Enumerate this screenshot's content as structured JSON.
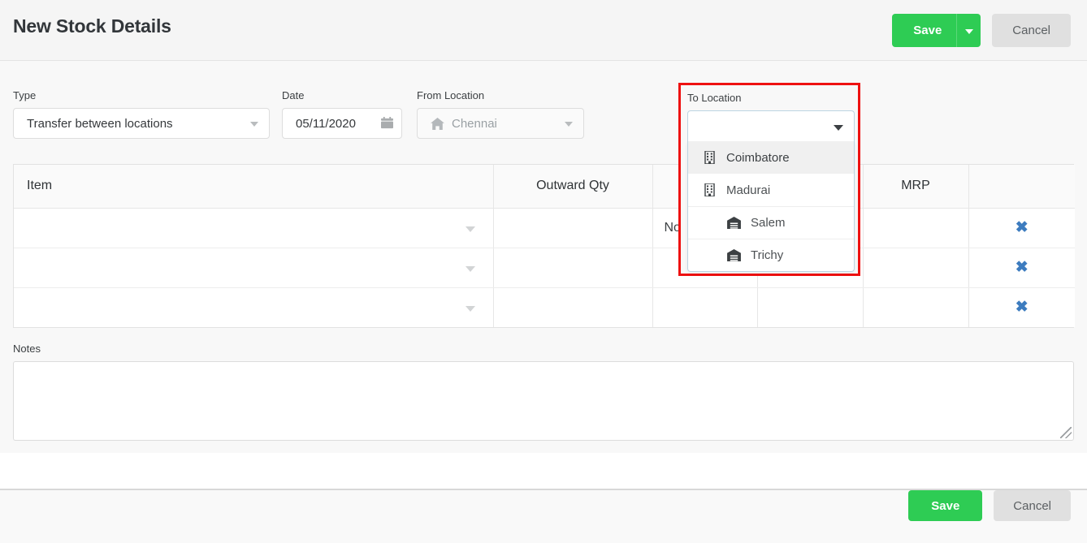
{
  "header": {
    "title": "New Stock Details",
    "save_label": "Save",
    "cancel_label": "Cancel"
  },
  "form": {
    "type": {
      "label": "Type",
      "value": "Transfer between locations"
    },
    "date": {
      "label": "Date",
      "value": "05/11/2020",
      "icon": "calendar-icon"
    },
    "from_location": {
      "label": "From Location",
      "value": "Chennai",
      "icon": "home-icon",
      "disabled": true
    },
    "to_location": {
      "label": "To Location",
      "value": "",
      "open": true,
      "highlight_color": "#ee1111",
      "options": [
        {
          "label": "Coimbatore",
          "icon": "building-icon",
          "selected": true,
          "indent": false
        },
        {
          "label": "Madurai",
          "icon": "building-icon",
          "selected": false,
          "indent": false
        },
        {
          "label": "Salem",
          "icon": "warehouse-icon",
          "selected": false,
          "indent": true
        },
        {
          "label": "Trichy",
          "icon": "warehouse-icon",
          "selected": false,
          "indent": true
        }
      ]
    }
  },
  "table": {
    "columns": [
      "Item",
      "Outward Qty",
      "",
      "MRP",
      ""
    ],
    "rows": [
      {
        "item": "",
        "outward_qty": "",
        "uom": "Nos",
        "mrp": "",
        "remove": "✖"
      },
      {
        "item": "",
        "outward_qty": "",
        "uom": "",
        "mrp": "",
        "remove": "✖"
      },
      {
        "item": "",
        "outward_qty": "",
        "uom": "",
        "mrp": "",
        "remove": "✖"
      }
    ]
  },
  "notes": {
    "label": "Notes",
    "value": "",
    "placeholder": ""
  },
  "footer": {
    "save_label": "Save",
    "cancel_label": "Cancel"
  },
  "colors": {
    "accent_green": "#2ecc54",
    "link_blue": "#3d7cbf",
    "highlight_red": "#ee1111"
  }
}
